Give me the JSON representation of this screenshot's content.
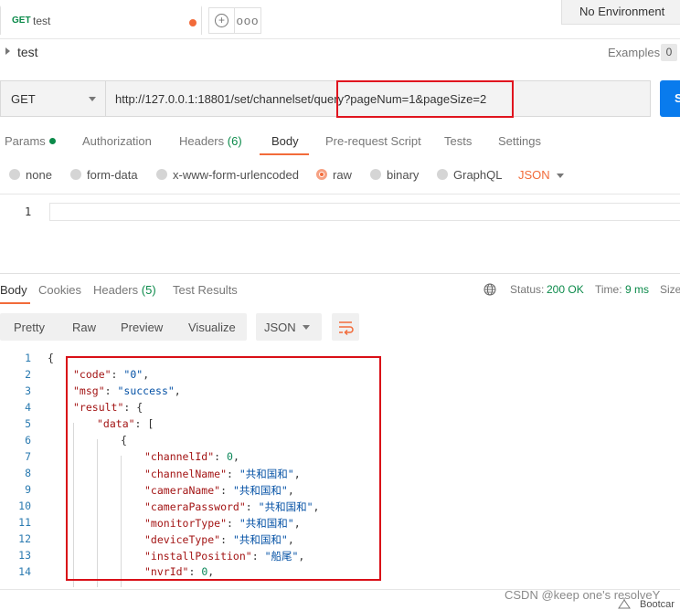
{
  "tab": {
    "method": "GET",
    "name": "test"
  },
  "environment": {
    "selected": "No Environment"
  },
  "request": {
    "name": "test",
    "examples_label": "Examples",
    "examples_count": "0",
    "method": "GET",
    "url": "http://127.0.0.1:18801/set/channelset/query?pageNum=1&pageSize=2",
    "send_label": "S"
  },
  "request_tabs": {
    "params": "Params",
    "authorization": "Authorization",
    "headers": "Headers",
    "headers_count": "(6)",
    "body": "Body",
    "prerequest": "Pre-request Script",
    "tests": "Tests",
    "settings": "Settings"
  },
  "body_types": {
    "none": "none",
    "form_data": "form-data",
    "urlencoded": "x-www-form-urlencoded",
    "raw": "raw",
    "binary": "binary",
    "graphql": "GraphQL",
    "language": "JSON"
  },
  "request_editor": {
    "line": "1"
  },
  "response_tabs": {
    "body": "Body",
    "cookies": "Cookies",
    "headers": "Headers",
    "headers_count": "(5)",
    "test_results": "Test Results",
    "status_label": "Status:",
    "status_value": "200 OK",
    "time_label": "Time:",
    "time_value": "9 ms",
    "size_label": "Size"
  },
  "response_toolbar": {
    "pretty": "Pretty",
    "raw": "Raw",
    "preview": "Preview",
    "visualize": "Visualize",
    "format": "JSON"
  },
  "response_lines": [
    {
      "num": "1",
      "text": "{"
    },
    {
      "num": "2",
      "key": "\"code\"",
      "sep": ": ",
      "val": "\"0\"",
      "vtype": "s",
      "end": ","
    },
    {
      "num": "3",
      "key": "\"msg\"",
      "sep": ": ",
      "val": "\"success\"",
      "vtype": "s",
      "end": ","
    },
    {
      "num": "4",
      "key": "\"result\"",
      "sep": ": ",
      "val": "{",
      "vtype": "p",
      "end": ""
    },
    {
      "num": "5",
      "key": "\"data\"",
      "sep": ": ",
      "val": "[",
      "vtype": "p",
      "end": ""
    },
    {
      "num": "6",
      "text": "{"
    },
    {
      "num": "7",
      "key": "\"channelId\"",
      "sep": ": ",
      "val": "0",
      "vtype": "n",
      "end": ","
    },
    {
      "num": "8",
      "key": "\"channelName\"",
      "sep": ": ",
      "val": "\"共和国和\"",
      "vtype": "s",
      "end": ","
    },
    {
      "num": "9",
      "key": "\"cameraName\"",
      "sep": ": ",
      "val": "\"共和国和\"",
      "vtype": "s",
      "end": ","
    },
    {
      "num": "10",
      "key": "\"cameraPassword\"",
      "sep": ": ",
      "val": "\"共和国和\"",
      "vtype": "s",
      "end": ","
    },
    {
      "num": "11",
      "key": "\"monitorType\"",
      "sep": ": ",
      "val": "\"共和国和\"",
      "vtype": "s",
      "end": ","
    },
    {
      "num": "12",
      "key": "\"deviceType\"",
      "sep": ": ",
      "val": "\"共和国和\"",
      "vtype": "s",
      "end": ","
    },
    {
      "num": "13",
      "key": "\"installPosition\"",
      "sep": ": ",
      "val": "\"船尾\"",
      "vtype": "s",
      "end": ","
    },
    {
      "num": "14",
      "key": "\"nvrId\"",
      "sep": ": ",
      "val": "0",
      "vtype": "n",
      "end": ","
    }
  ],
  "footer": {
    "watermark": "CSDN @keep one's resolveY",
    "bootcamp": "Bootcar"
  }
}
